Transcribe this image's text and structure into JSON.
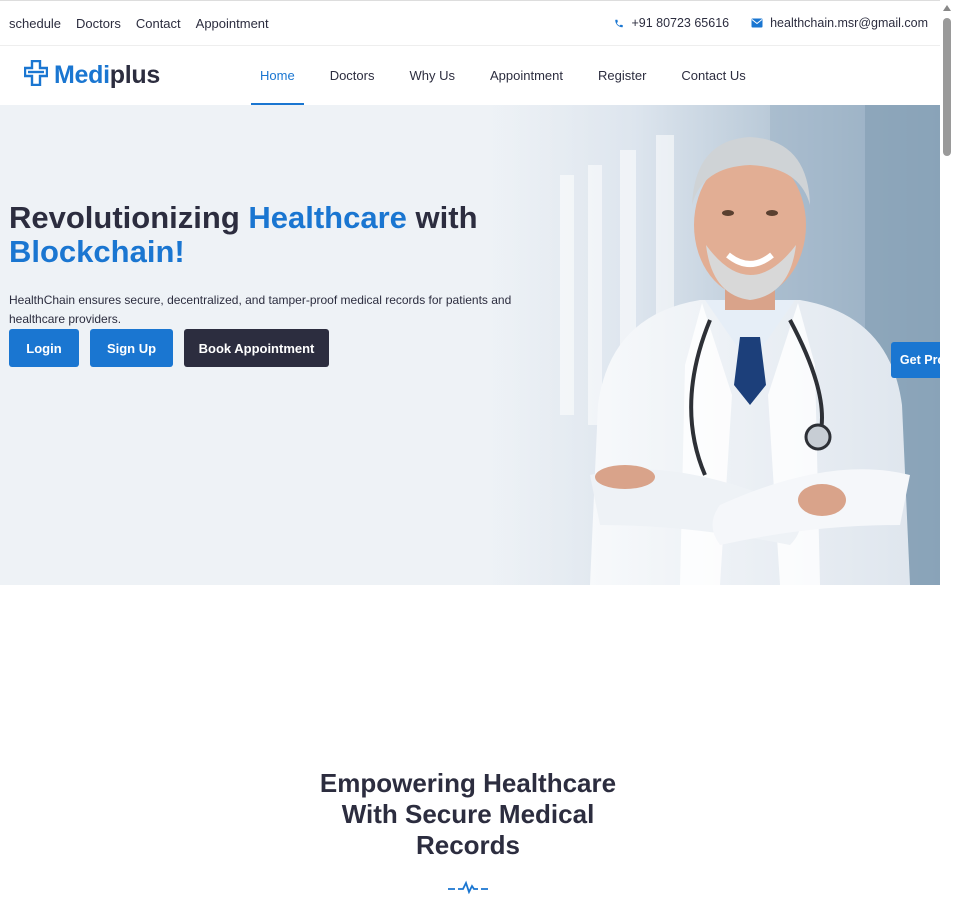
{
  "topbar": {
    "links": [
      "schedule",
      "Doctors",
      "Contact",
      "Appointment"
    ],
    "phone": "+91 80723 65616",
    "email": "healthchain.msr@gmail.com"
  },
  "header": {
    "logo_part1": "Medi",
    "logo_part2": "plus",
    "nav": [
      "Home",
      "Doctors",
      "Why Us",
      "Appointment",
      "Register",
      "Contact Us"
    ],
    "active_nav": "Home"
  },
  "hero": {
    "title_1": "Revolutionizing ",
    "title_2": "Healthcare",
    "title_3": " with",
    "title_4": "Blockchain!",
    "description": "HealthChain ensures secure, decentralized, and tamper-proof medical records for patients and healthcare providers.",
    "login_label": "Login",
    "signup_label": "Sign Up",
    "book_label": "Book Appointment"
  },
  "floating": {
    "get_pro_label": "Get Pro"
  },
  "section": {
    "title": "Empowering Healthcare With Secure Medical Records"
  },
  "colors": {
    "primary": "#1a76d1",
    "dark": "#2c2d3f"
  },
  "icons": {
    "phone": "phone-icon",
    "email": "envelope-icon",
    "logo": "medical-cross-icon",
    "pulse": "heartbeat-icon"
  }
}
